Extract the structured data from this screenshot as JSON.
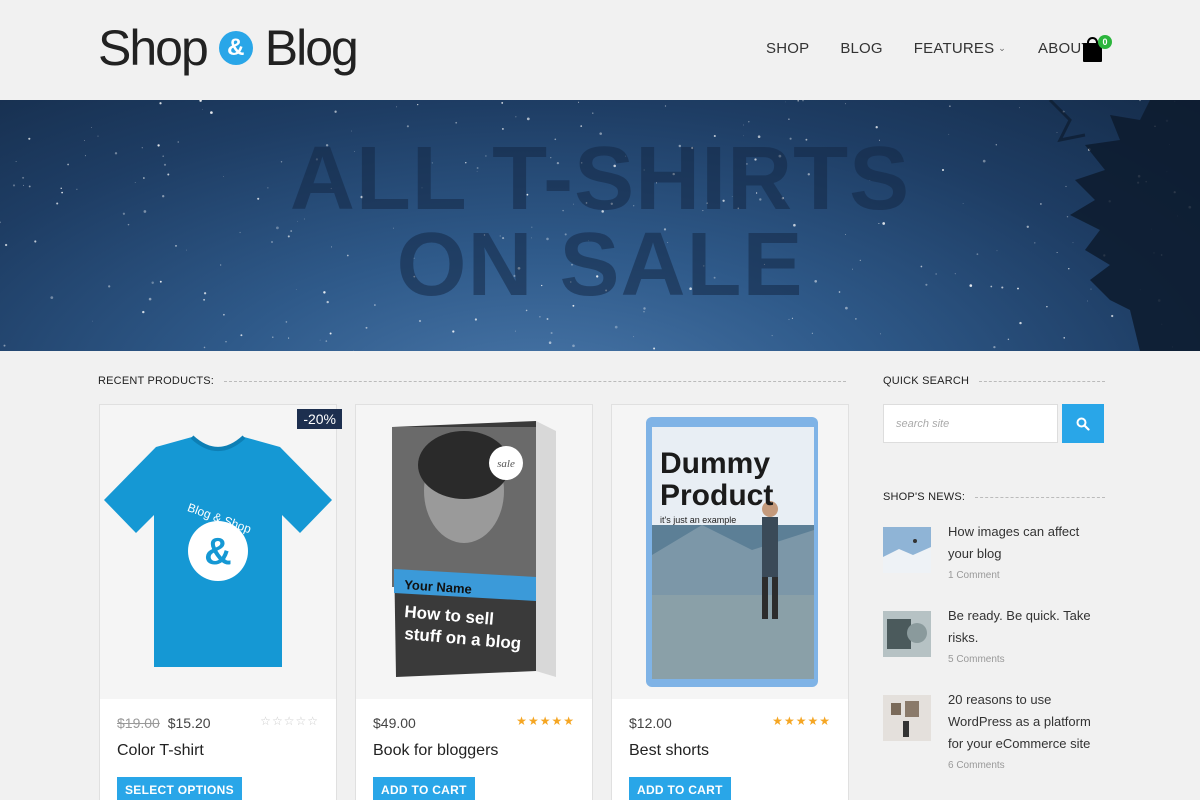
{
  "site": {
    "logo_left": "Shop",
    "logo_amp": "&",
    "logo_right": "Blog"
  },
  "nav": {
    "items": [
      "SHOP",
      "BLOG",
      "FEATURES",
      "ABOUT"
    ],
    "cart_count": "0"
  },
  "hero": {
    "line1": "ALL T-SHIRTS",
    "line2": "ON SALE"
  },
  "sections": {
    "recent_products": "RECENT PRODUCTS:",
    "quick_search": "QUICK SEARCH",
    "shops_news": "SHOP'S NEWS:"
  },
  "products": [
    {
      "name": "Color T-shirt",
      "old_price": "$19.00",
      "price": "$15.20",
      "badge": "-20%",
      "rating": 0,
      "button": "SELECT OPTIONS",
      "image_text": "Blog & Shop"
    },
    {
      "name": "Book for bloggers",
      "old_price": "",
      "price": "$49.00",
      "badge": "",
      "rating": 4.5,
      "button": "ADD TO CART",
      "image_badge": "sale",
      "image_band": "Your Name",
      "image_title_1": "How to sell",
      "image_title_2": "stuff on a blog"
    },
    {
      "name": "Best shorts",
      "old_price": "",
      "price": "$12.00",
      "badge": "",
      "rating": 4.5,
      "button": "ADD TO CART",
      "image_title_1": "Dummy",
      "image_title_2": "Product",
      "image_sub": "it's just an example"
    }
  ],
  "search": {
    "placeholder": "search site"
  },
  "news": [
    {
      "title": "How images can affect your blog",
      "comments": "1 Comment"
    },
    {
      "title": "Be ready. Be quick. Take risks.",
      "comments": "5 Comments"
    },
    {
      "title": "20 reasons to use WordPress as a platform for your eCommerce site",
      "comments": "6 Comments"
    }
  ],
  "colors": {
    "accent": "#29a6e8",
    "badge_bg": "#1d2f4f",
    "star": "#f5a623",
    "cart_badge": "#2bb53c"
  },
  "icons": [
    "cart-icon",
    "search-icon",
    "chevron-down-icon",
    "star-icon"
  ]
}
